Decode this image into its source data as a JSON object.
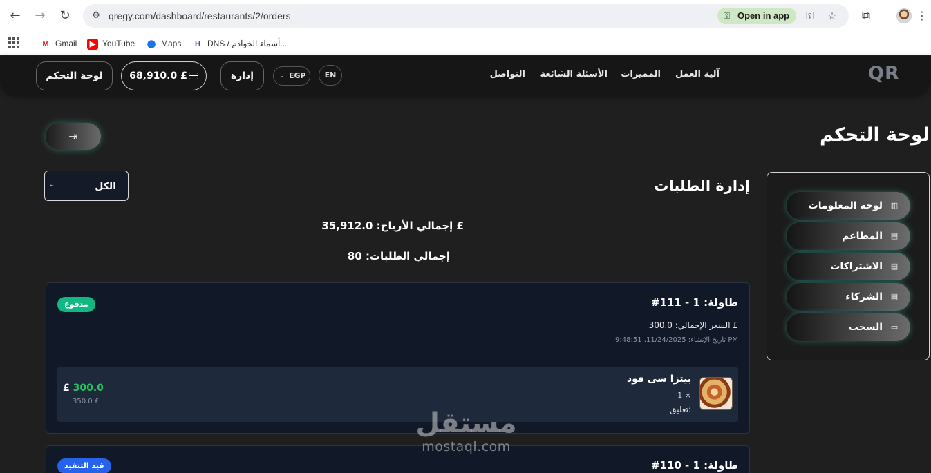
{
  "browser": {
    "url": "qregy.com/dashboard/restaurants/2/orders",
    "open_in_app": "Open in app",
    "icons": {
      "back": "←",
      "forward": "→",
      "reload": "↻",
      "site_info": "⚙",
      "key": "⚿",
      "star": "☆",
      "extensions": "⧉",
      "menu": "⋮"
    }
  },
  "bookmarks": [
    {
      "label": "Gmail",
      "icon": "M"
    },
    {
      "label": "YouTube",
      "icon": "▶"
    },
    {
      "label": "Maps",
      "icon": "⬤"
    },
    {
      "label": "DNS / أسماء الخوادم...",
      "icon": "H"
    }
  ],
  "site_nav": {
    "logo": "QR",
    "links": [
      "آلية العمل",
      "المميزات",
      "الأسئلة الشائعة",
      "التواصل"
    ],
    "lang": "EN",
    "currency": "EGP",
    "currency_chevron": "⌄",
    "admin_button": "إدارة",
    "balance": "68,910.0 £",
    "dashboard_button": "لوحة التحكم"
  },
  "page": {
    "title": "لوحة التحكم",
    "logout_icon": "⇥"
  },
  "sidebar": {
    "items": [
      {
        "label": "لوحة المعلومات",
        "icon": "▥"
      },
      {
        "label": "المطاعم",
        "icon": "▤"
      },
      {
        "label": "الاشتراكات",
        "icon": "▤"
      },
      {
        "label": "الشركاء",
        "icon": "▤"
      },
      {
        "label": "السحب",
        "icon": "▭"
      }
    ]
  },
  "orders": {
    "title": "إدارة الطلبات",
    "filter": {
      "value": "الكل",
      "chevron": "⌄"
    },
    "total_profit": "إجمالي الأرباح: 35,912.0 £",
    "total_orders": "إجمالي الطلبات: 80",
    "cards": [
      {
        "header": "#111 - طاولة: 1",
        "status": "مدفوع",
        "status_color": "#10b981",
        "total_price": "السعر الإجمالي: 300.0 £",
        "created": "تاريخ الإنشاء: 11/24/2025, 9:48:51 PM",
        "items": [
          {
            "name": "بيتزا سى فود",
            "qty": "1 ×",
            "note": "تعليق:",
            "price": "300.0",
            "currency": "£",
            "old_price": "350.0 £"
          }
        ]
      },
      {
        "header": "#110 - طاولة: 1",
        "status": "قيد التنفيذ",
        "status_color": "#2563eb"
      }
    ]
  },
  "watermark": {
    "ar": "مستقل",
    "en": "mostaql.com"
  }
}
